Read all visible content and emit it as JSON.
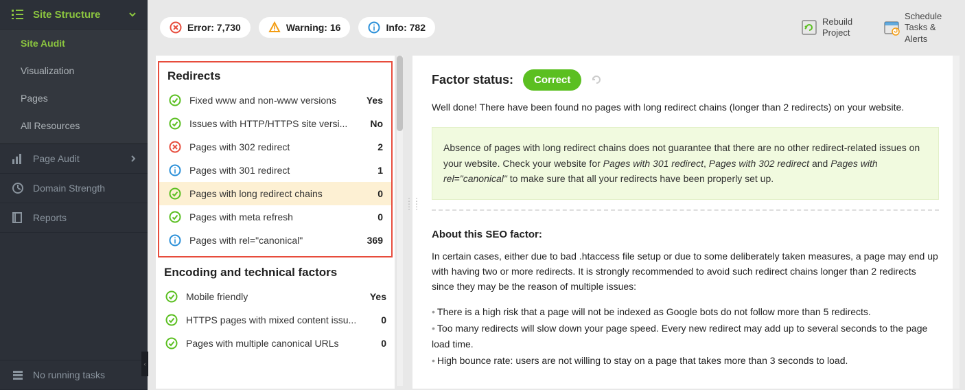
{
  "sidebar": {
    "header": "Site Structure",
    "sub": [
      "Site Audit",
      "Visualization",
      "Pages",
      "All Resources"
    ],
    "pageAudit": "Page Audit",
    "domainStrength": "Domain Strength",
    "reports": "Reports",
    "tasks": "No running tasks"
  },
  "topbar": {
    "errorLabel": "Error: 7,730",
    "warningLabel": "Warning: 16",
    "infoLabel": "Info: 782",
    "rebuild": "Rebuild Project",
    "schedule": "Schedule Tasks & Alerts"
  },
  "left": {
    "redirectsTitle": "Redirects",
    "rows": [
      {
        "label": "Fixed www and non-www versions",
        "value": "Yes",
        "type": "ok"
      },
      {
        "label": "Issues with HTTP/HTTPS site versi...",
        "value": "No",
        "type": "ok"
      },
      {
        "label": "Pages with 302 redirect",
        "value": "2",
        "type": "err"
      },
      {
        "label": "Pages with 301 redirect",
        "value": "1",
        "type": "info"
      },
      {
        "label": "Pages with long redirect chains",
        "value": "0",
        "type": "ok"
      },
      {
        "label": "Pages with meta refresh",
        "value": "0",
        "type": "ok"
      },
      {
        "label": "Pages with rel=\"canonical\"",
        "value": "369",
        "type": "info"
      }
    ],
    "encodingTitle": "Encoding and technical factors",
    "enc": [
      {
        "label": "Mobile friendly",
        "value": "Yes",
        "type": "ok"
      },
      {
        "label": "HTTPS pages with mixed content issu...",
        "value": "0",
        "type": "ok"
      },
      {
        "label": "Pages with multiple canonical URLs",
        "value": "0",
        "type": "ok"
      }
    ]
  },
  "right": {
    "factorStatusLabel": "Factor status:",
    "badge": "Correct",
    "summary": "Well done! There have been found no pages with long redirect chains (longer than 2 redirects) on your website.",
    "note_pre": "Absence of pages with long redirect chains does not guarantee that there are no other redirect-related issues on your website. Check your website for ",
    "note_i1": "Pages with 301 redirect",
    "note_c1": ", ",
    "note_i2": "Pages with 302 redirect",
    "note_c2": " and ",
    "note_i3": "Pages with rel=\"canonical\"",
    "note_post": "  to make sure that all your redirects have been properly set up.",
    "aboutHead": "About this SEO factor:",
    "aboutP": "In certain cases, either due to bad .htaccess file setup or due to some deliberately taken measures, a page may end up with having two or more redirects. It is strongly recommended to avoid such redirect chains longer than 2 redirects since they may be the reason of multiple issues:",
    "b1": "There is a high risk that a page will not be indexed as Google bots do not follow more than 5 redirects.",
    "b2": "Too many redirects will slow down your page speed. Every new redirect may add up to several seconds to the page load time.",
    "b3": "High bounce rate: users are not willing to stay on a page that takes more than 3 seconds to load."
  }
}
